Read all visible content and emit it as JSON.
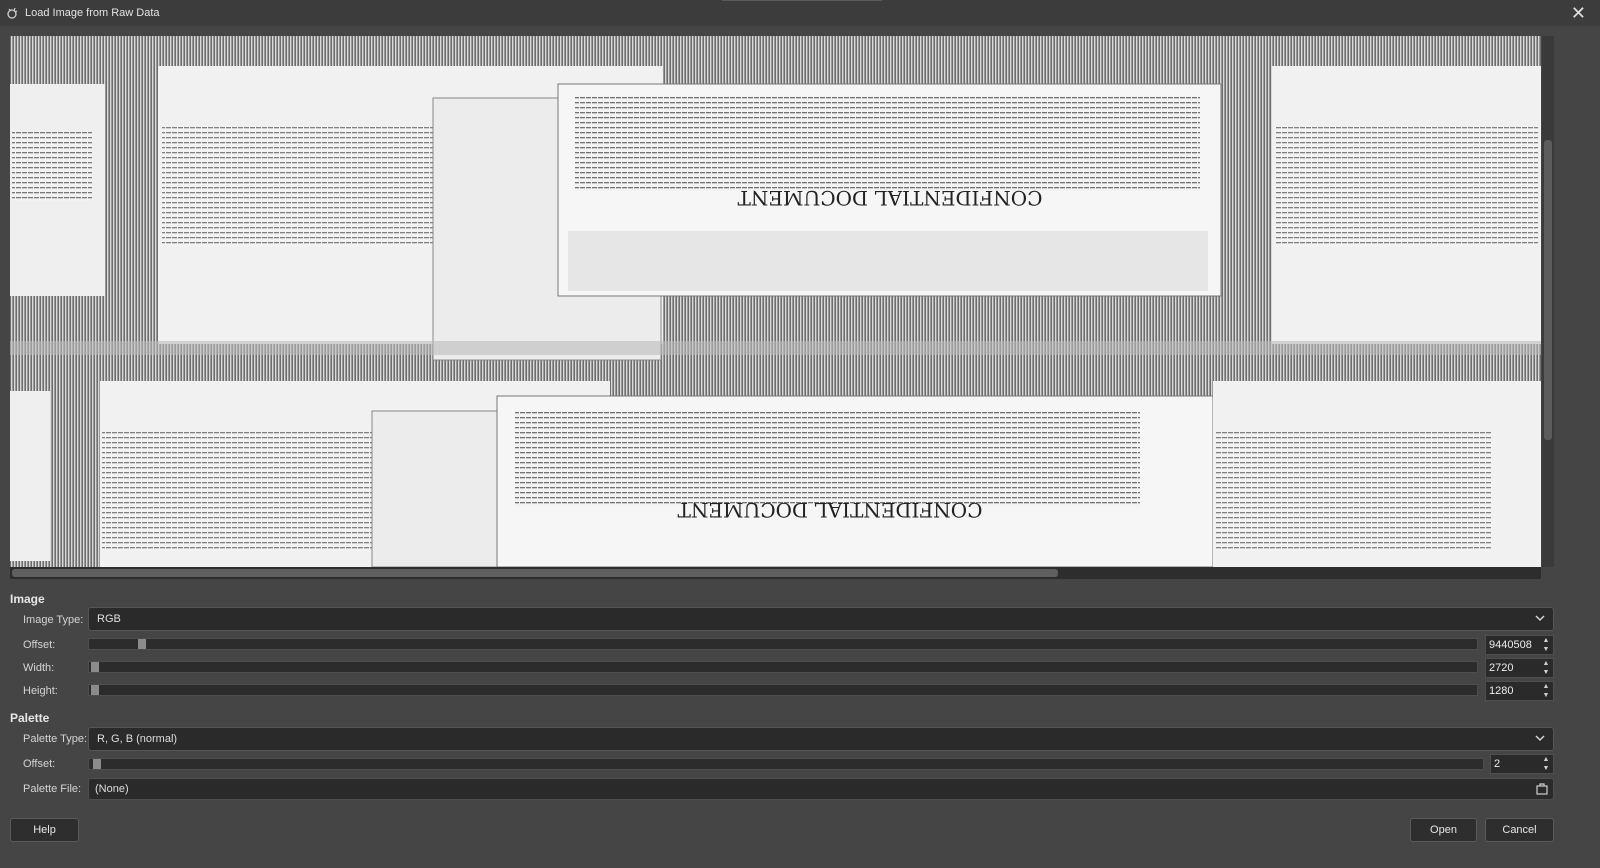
{
  "window": {
    "title": "Load Image from Raw Data",
    "icon": "gimp-wilber-icon",
    "close_glyph": "✕"
  },
  "preview": {
    "texts": {
      "doc_heading": "CONFIDENTIAL DOCUMENT"
    }
  },
  "image": {
    "section_label": "Image",
    "type_label": "Image Type:",
    "type_value": "RGB",
    "offset_label": "Offset:",
    "offset_value": "9440508",
    "offset_fraction": 0.03,
    "width_label": "Width:",
    "width_value": "2720",
    "width_fraction": 0.0,
    "height_label": "Height:",
    "height_value": "1280",
    "height_fraction": 0.0
  },
  "palette": {
    "section_label": "Palette",
    "type_label": "Palette Type:",
    "type_value": "R, G, B (normal)",
    "offset_label": "Offset:",
    "offset_value": "2",
    "offset_fraction": 0.0,
    "file_label": "Palette File:",
    "file_value": "(None)"
  },
  "buttons": {
    "help": "Help",
    "open": "Open",
    "cancel": "Cancel"
  },
  "colors": {
    "background": "#454545",
    "field": "#2a2a2a"
  }
}
